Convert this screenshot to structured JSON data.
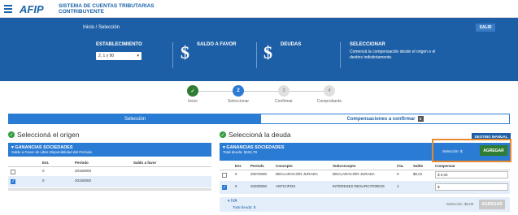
{
  "header": {
    "logo_text": "AFIP",
    "brand_line1": "SISTEMA DE CUENTAS TRIBUTARIAS",
    "brand_line2": "CONTRIBUYENTE"
  },
  "hero": {
    "breadcrumb": "Inicio / Selección",
    "salir": "SALIR",
    "establecimiento_label": "ESTABLECIMIENTO",
    "establecimiento_value": "2, 1 y 90",
    "saldo_label": "SALDO A FAVOR",
    "deudas_label": "DEUDAS",
    "seleccionar_label": "SELECCIONAR",
    "seleccionar_text": "Comenzá la compensación desde el origen o el destino indistintamente."
  },
  "steps": [
    {
      "label": "Inicio",
      "n": "✓"
    },
    {
      "label": "Seleccionar",
      "n": "2"
    },
    {
      "label": "Confirmar",
      "n": "3"
    },
    {
      "label": "Comprobante",
      "n": "4"
    }
  ],
  "tabs": {
    "seleccion": "Selección",
    "compensaciones": "Compensaciones a confirmar",
    "badge": "0"
  },
  "origen": {
    "title": "Seleccioná el origen",
    "panel_title": "GANANCIAS SOCIEDADES",
    "panel_sub": "Saldo a Favor de Libre Disponibilidad del Período",
    "cols": [
      "Est.",
      "Período",
      "Saldo a favor"
    ],
    "rows": [
      {
        "est": "0",
        "periodo": "20160000",
        "saldo": ""
      },
      {
        "est": "0",
        "periodo": "20150000",
        "saldo": ""
      }
    ]
  },
  "deuda": {
    "title": "Seleccioná la deuda",
    "destino_manual": "DESTINO MANUAL",
    "panel_title": "GANANCIAS SOCIEDADES",
    "panel_sub": "Total deuda: $402,79",
    "seleccion_text": "Selección: $",
    "agregar": "AGREGAR",
    "cols": [
      "Est.",
      "Período",
      "Concepto",
      "Subconcepto",
      "Cta.",
      "Saldo",
      "Compensar"
    ],
    "rows": [
      {
        "est": "0",
        "periodo": "20070000",
        "concepto": "DECLARACIÓN JURADA",
        "sub": "DECLARACIÓN JURADA",
        "cta": "0",
        "saldo": "$0,01",
        "comp": "$ 0,00"
      },
      {
        "est": "0",
        "periodo": "20200000",
        "concepto": "ANTICIPOS",
        "sub": "INTERESES RESARCITORIOS",
        "cta": "1",
        "saldo": "",
        "comp": "$"
      }
    ],
    "iva_title": "IVA",
    "iva_sub": "Total deuda: $",
    "iva_seleccion": "Selección: $0,00",
    "iva_agregar": "AGREGAR"
  }
}
